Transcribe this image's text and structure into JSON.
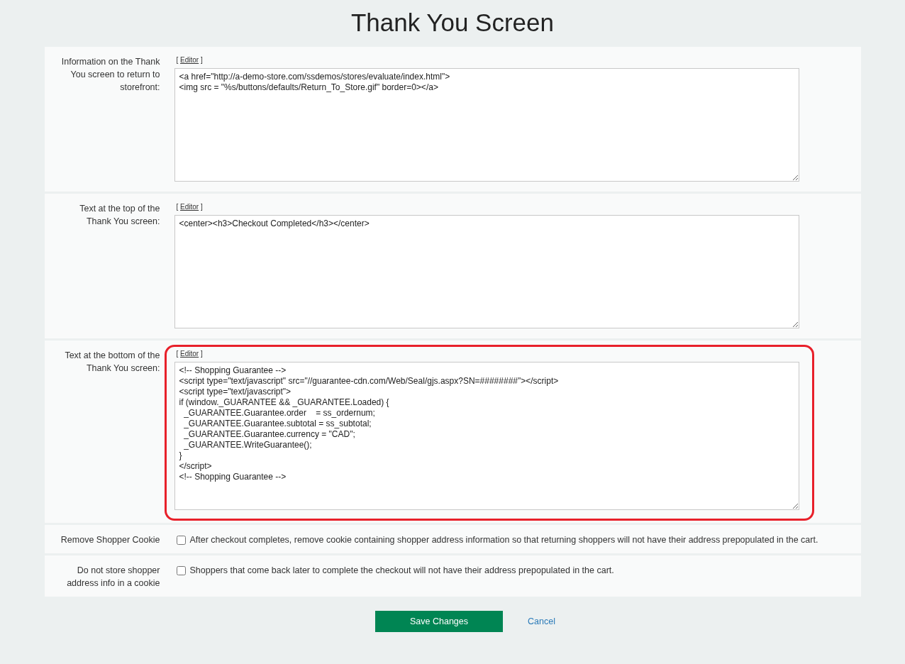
{
  "title": "Thank You Screen",
  "sections": [
    {
      "kind": "code",
      "label": "Information on the Thank You screen to return to storefront:",
      "bracket_open": "[",
      "editor_link": "Editor",
      "bracket_close": "]",
      "value": "<a href=\"http://a-demo-store.com/ssdemos/stores/evaluate/index.html\">\n<img src = \"%s/buttons/defaults/Return_To_Store.gif\" border=0></a>",
      "highlighted": false
    },
    {
      "kind": "code",
      "label": "Text at the top of the Thank You screen:",
      "bracket_open": "[",
      "editor_link": "Editor",
      "bracket_close": "]",
      "value": "<center><h3>Checkout Completed</h3></center>",
      "highlighted": false
    },
    {
      "kind": "code",
      "label": "Text at the bottom of the Thank You screen:",
      "bracket_open": "[",
      "editor_link": "Editor",
      "bracket_close": "]",
      "value": "<!-- Shopping Guarantee -->\n<script type=\"text/javascript\" src=\"//guarantee-cdn.com/Web/Seal/gjs.aspx?SN=########\"></script>\n<script type=\"text/javascript\">\nif (window._GUARANTEE && _GUARANTEE.Loaded) {\n  _GUARANTEE.Guarantee.order    = ss_ordernum;\n  _GUARANTEE.Guarantee.subtotal = ss_subtotal;\n  _GUARANTEE.Guarantee.currency = \"CAD\";\n  _GUARANTEE.WriteGuarantee();\n}\n</script>\n<!-- Shopping Guarantee -->",
      "highlighted": true
    },
    {
      "kind": "checkbox",
      "label": "Remove Shopper Cookie",
      "text": "After checkout completes, remove cookie containing shopper address information so that returning shoppers will not have their address prepopulated in the cart.",
      "checked": false
    },
    {
      "kind": "checkbox",
      "label": "Do not store shopper address info in a cookie",
      "text": "Shoppers that come back later to complete the checkout will not have their address prepopulated in the cart.",
      "checked": false
    }
  ],
  "buttons": {
    "save": "Save Changes",
    "cancel": "Cancel"
  }
}
